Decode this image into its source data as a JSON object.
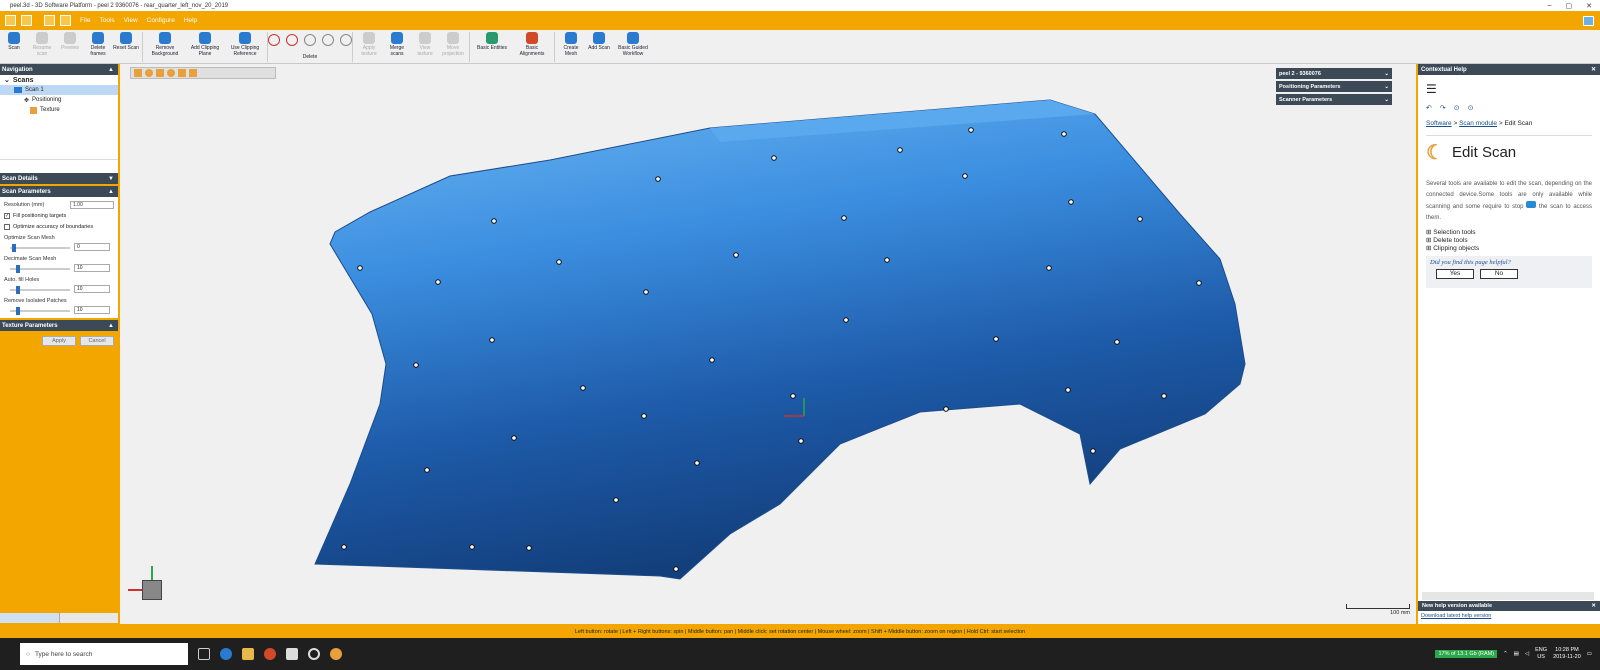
{
  "window": {
    "title": "peel.3d - 3D Software Platform - peel 2 9360076 - rear_quarter_left_nov_20_2019"
  },
  "menu": [
    "File",
    "Tools",
    "View",
    "Configure",
    "Help"
  ],
  "ribbon": {
    "groups": [
      {
        "label": "Scan",
        "enabled": true,
        "color": "#2a7bd0"
      },
      {
        "label": "Resume scan",
        "enabled": false,
        "color": "#999"
      },
      {
        "label": "Preview",
        "enabled": false,
        "color": "#999"
      },
      {
        "label": "Delete frames",
        "enabled": true,
        "color": "#2a7bd0"
      },
      {
        "label": "Reset Scan",
        "enabled": true,
        "color": "#2a7bd0"
      },
      {
        "label": "Remove Background",
        "enabled": true,
        "color": "#2a7bd0"
      },
      {
        "label": "Add Clipping Plane",
        "enabled": true,
        "color": "#2a7bd0"
      },
      {
        "label": "Use Clipping Reference",
        "enabled": true,
        "color": "#2a7bd0"
      }
    ],
    "delete_group_label": "Delete",
    "groups2": [
      {
        "label": "Apply texture",
        "enabled": false
      },
      {
        "label": "Merge scans",
        "enabled": true
      },
      {
        "label": "View texture",
        "enabled": false
      },
      {
        "label": "Move projection",
        "enabled": false
      },
      {
        "label": "Basic Entities",
        "enabled": true
      },
      {
        "label": "Basic Alignments",
        "enabled": true
      },
      {
        "label": "Create Mesh",
        "enabled": true
      },
      {
        "label": "Add Scan",
        "enabled": true
      },
      {
        "label": "Basic Guided Workflow",
        "enabled": true
      }
    ]
  },
  "navigation": {
    "title": "Navigation",
    "root": "Scans",
    "items": [
      "Scan 1",
      "Positioning",
      "Texture"
    ]
  },
  "scan_details": {
    "title": "Scan Details"
  },
  "scan_params": {
    "title": "Scan Parameters",
    "resolution_label": "Resolution (mm)",
    "resolution_value": "1.00",
    "fill_targets": "Fill positioning targets",
    "optimize_boundaries": "Optimize accuracy of boundaries",
    "optimize_mesh": "Optimize Scan Mesh",
    "optimize_mesh_value": "0",
    "decimate": "Decimate Scan Mesh",
    "decimate_value": "10",
    "autofill": "Auto. fill Holes",
    "autofill_value": "10",
    "remove_patches": "Remove Isolated Patches",
    "remove_patches_value": "10"
  },
  "texture_params": {
    "title": "Texture Parameters"
  },
  "buttons": {
    "apply": "Apply",
    "cancel": "Cancel"
  },
  "viewport_panels": {
    "scanner": "peel 2 - 9360076",
    "positioning": "Positioning Parameters",
    "scanner_params": "Scanner Parameters"
  },
  "scale_bar": "100 mm",
  "help": {
    "title": "Contextual Help",
    "breadcrumb": [
      "Software",
      "Scan module",
      "Edit Scan"
    ],
    "heading": "Edit Scan",
    "body1": "Several tools are available to edit the scan, depending on the connected device.Some tools are only available while scanning and some require to stop",
    "body2": "the scan to access them.",
    "list": [
      "Selection tools",
      "Delete tools",
      "Clipping objects"
    ],
    "feedback_q": "Did you find this page helpful?",
    "yes": "Yes",
    "no": "No",
    "new_version": "New help version available",
    "download": "Download latest help version"
  },
  "statusbar": "Left button: rotate | Left + Right buttons: spin | Middle button: pan | Middle click: set rotation center | Mouse wheel: zoom | Shift + Middle button: zoom on region | Hold Ctrl: start selection",
  "taskbar": {
    "search_placeholder": "Type here to search",
    "memory": "17% of 13.1 Gb (RAM)",
    "lang": "ENG",
    "region": "US",
    "time": "10:28 PM",
    "date": "2019-11-20"
  },
  "colors": {
    "accent": "#f3a600",
    "panel_header": "#3c4a57",
    "mesh": "#2a6fd0"
  }
}
